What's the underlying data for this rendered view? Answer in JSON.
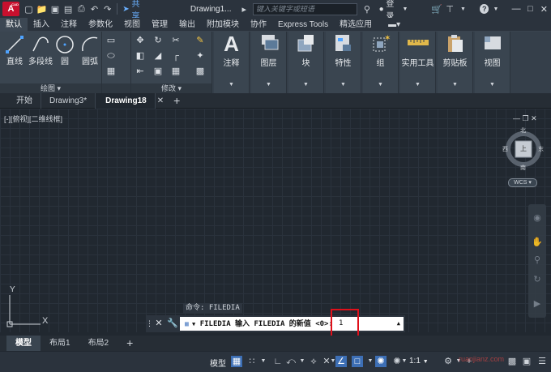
{
  "app": {
    "logo_letter": "A",
    "logo_sub": "CAD",
    "doc_title": "Drawing1...",
    "share_label": "共享",
    "search_placeholder": "键入关键字或短语",
    "login_label": "登录",
    "help_label": "?"
  },
  "colors": {
    "accent": "#c8102e",
    "canvas": "#212830",
    "highlight": "#e0101a",
    "link": "#6ab0ff"
  },
  "ribbon_tabs": [
    "默认",
    "插入",
    "注释",
    "参数化",
    "视图",
    "管理",
    "输出",
    "附加模块",
    "协作",
    "Express Tools",
    "精选应用"
  ],
  "draw_panel": {
    "tools": [
      "直线",
      "多段线",
      "圆",
      "圆弧"
    ],
    "footer": "绘图"
  },
  "modify_panel": {
    "footer": "修改"
  },
  "big_tools": [
    "注释",
    "图层",
    "块",
    "特性",
    "组",
    "实用工具",
    "剪贴板",
    "视图"
  ],
  "doc_tabs": [
    "开始",
    "Drawing3*",
    "Drawing18"
  ],
  "viewport_label": "[-][俯视][二维线框]",
  "viewcube": {
    "north": "北",
    "south": "南",
    "east": "东",
    "west": "西",
    "top": "上",
    "wcs": "WCS"
  },
  "ucs": {
    "x": "X",
    "y": "Y"
  },
  "command": {
    "history": "命令: FILEDIA",
    "prompt": "FILEDIA 输入 FILEDIA 的新值 <0>:",
    "value": "1"
  },
  "layout_tabs": [
    "模型",
    "布局1",
    "布局2"
  ],
  "status": {
    "model_label": "模型",
    "scale_label": "1:1"
  },
  "watermark": "ruanjianz.com"
}
